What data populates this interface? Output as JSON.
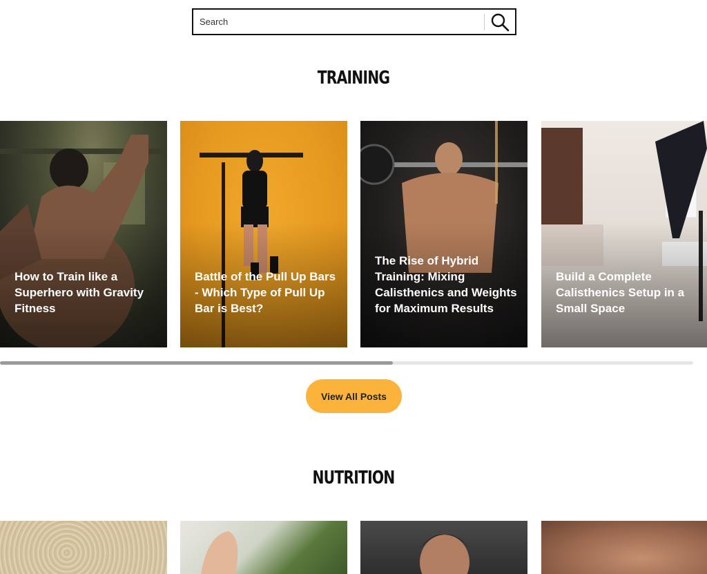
{
  "search": {
    "placeholder": "Search"
  },
  "training": {
    "heading": "TRAINING",
    "cards": [
      {
        "title": "How to Train like a Superhero with Gravity Fitness"
      },
      {
        "title": "Battle of the Pull Up Bars - Which Type of Pull Up Bar is Best?"
      },
      {
        "title": "The Rise of Hybrid Training: Mixing Calisthenics and Weights for Maximum Results"
      },
      {
        "title": "Build a Complete Calisthenics Setup in a Small Space"
      }
    ],
    "view_all_label": "View All Posts"
  },
  "nutrition": {
    "heading": "NUTRITION"
  },
  "colors": {
    "accent": "#fbb33c",
    "text": "#111111"
  }
}
